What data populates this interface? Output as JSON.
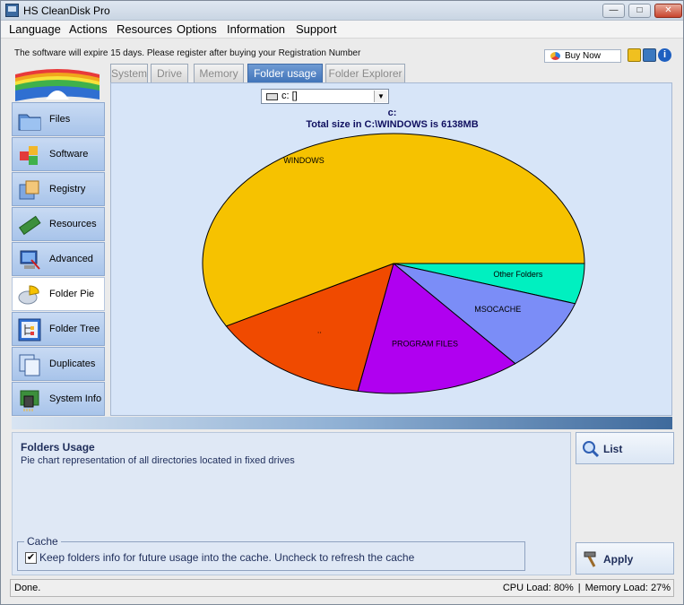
{
  "window": {
    "title": "HS CleanDisk Pro",
    "controls": [
      "minimize",
      "maximize",
      "close"
    ]
  },
  "menu": [
    "Language",
    "Actions",
    "Resources",
    "Options",
    "Information",
    "Support"
  ],
  "notice": "The software will expire 15 days. Please register after buying your Registration Number",
  "toolbar": {
    "buy_now": "Buy Now",
    "icons": [
      "lock-icon",
      "save-icon",
      "info-icon"
    ]
  },
  "sidebar": {
    "items": [
      {
        "label": "Files",
        "icon": "folder-icon"
      },
      {
        "label": "Software",
        "icon": "boxes-icon"
      },
      {
        "label": "Registry",
        "icon": "registry-icon"
      },
      {
        "label": "Resources",
        "icon": "memory-icon"
      },
      {
        "label": "Advanced",
        "icon": "computer-icon"
      },
      {
        "label": "Folder Pie",
        "icon": "pie-icon"
      },
      {
        "label": "Folder Tree",
        "icon": "tree-icon"
      },
      {
        "label": "Duplicates",
        "icon": "duplicate-icon"
      },
      {
        "label": "System Info",
        "icon": "chip-icon"
      }
    ],
    "active": "Folder Pie"
  },
  "tabs": [
    {
      "label": "System",
      "active": false
    },
    {
      "label": "Drive",
      "active": false
    },
    {
      "label": "Memory",
      "active": false
    },
    {
      "label": "Folder usage",
      "active": true
    },
    {
      "label": "Folder Explorer",
      "active": false
    }
  ],
  "drive_select": {
    "value": "c: []"
  },
  "chart_heading": "c:",
  "chart_data": {
    "type": "pie",
    "title": "Total size in C:\\WINDOWS is 6138MB",
    "slices": [
      {
        "label": "Other Folders",
        "value": 5,
        "color": "#00f0c0"
      },
      {
        "label": "MSOCACHE",
        "value": 9,
        "color": "#7b8df7"
      },
      {
        "label": "PROGRAM FILES",
        "value": 14,
        "color": "#b000f0"
      },
      {
        "label": "..",
        "value": 14,
        "color": "#f04a00"
      },
      {
        "label": "WINDOWS",
        "value": 58,
        "color": "#f6c200"
      }
    ]
  },
  "info": {
    "title": "Folders Usage",
    "description": "Pie chart representation of all directories located in fixed drives",
    "cache_legend": "Cache",
    "cache_label": "Keep folders info for future usage into the cache. Uncheck to refresh the cache",
    "cache_checked": true
  },
  "buttons": {
    "list": "List",
    "apply": "Apply"
  },
  "status": {
    "left": "Done.",
    "cpu": "CPU Load: 80%",
    "memory": "Memory Load: 27%"
  }
}
